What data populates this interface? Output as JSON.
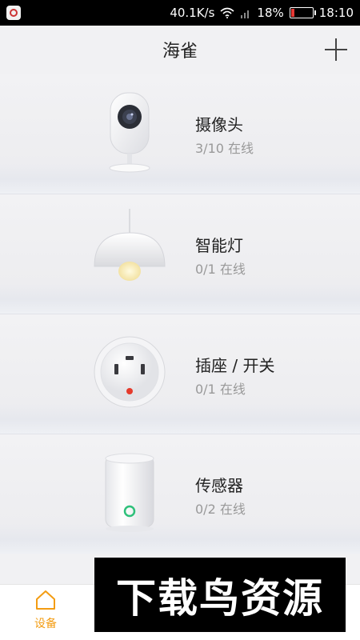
{
  "status_bar": {
    "network_speed": "40.1K/s",
    "battery_percent": "18%",
    "battery_level": 0.18,
    "time": "18:10",
    "icons": [
      "app-icon",
      "wifi-icon",
      "signal-icon",
      "battery-icon"
    ]
  },
  "header": {
    "title": "海雀",
    "add_icon": "plus-icon"
  },
  "devices": [
    {
      "name": "摄像头",
      "status": "3/10 在线",
      "icon": "camera-icon"
    },
    {
      "name": "智能灯",
      "status": "0/1 在线",
      "icon": "lamp-icon"
    },
    {
      "name": "插座 / 开关",
      "status": "0/1 在线",
      "icon": "socket-icon"
    },
    {
      "name": "传感器",
      "status": "0/2 在线",
      "icon": "sensor-icon"
    }
  ],
  "tab_bar": {
    "tabs": [
      {
        "label": "设备",
        "icon": "home-icon",
        "active": true
      }
    ],
    "active_color": "#f39c12"
  },
  "watermark": {
    "text": "下载鸟资源"
  }
}
